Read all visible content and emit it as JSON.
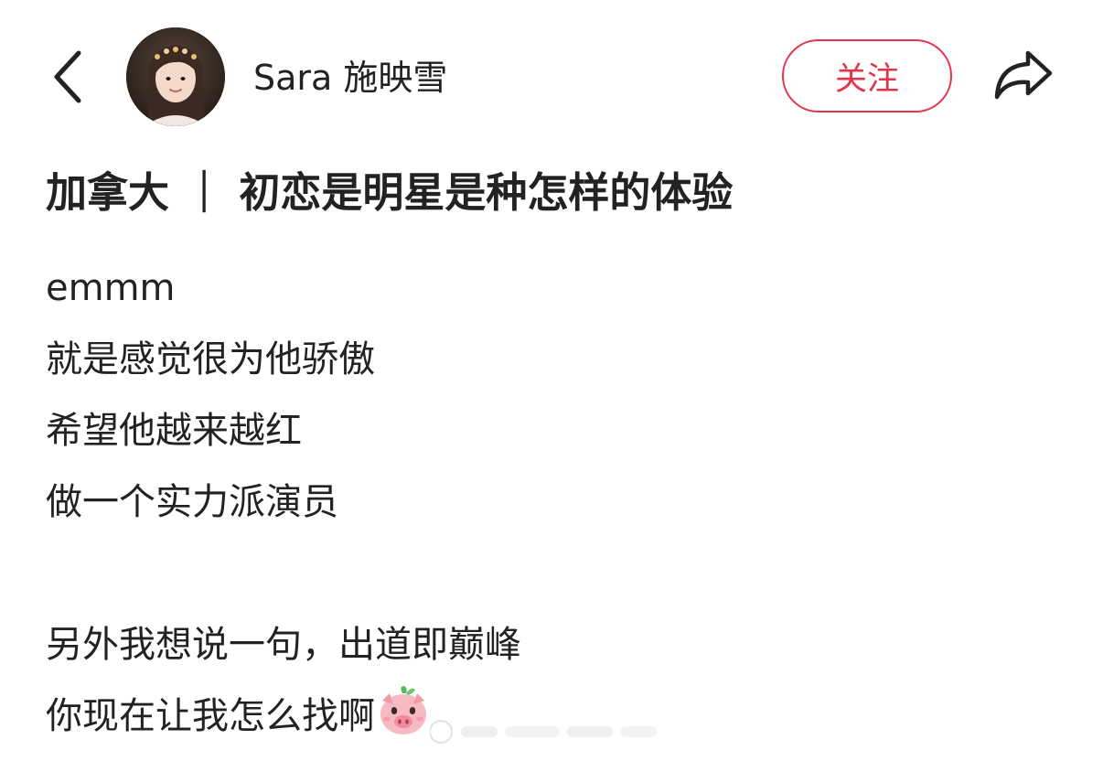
{
  "header": {
    "author_name": "Sara 施映雪",
    "follow_label": "关注"
  },
  "post": {
    "title": "加拿大 ｜ 初恋是明星是种怎样的体验",
    "lines": [
      "emmm",
      "就是感觉很为他骄傲",
      "希望他越来越红",
      "做一个实力派演员",
      "",
      "另外我想说一句，出道即巅峰",
      "你现在让我怎么找啊"
    ]
  },
  "icons": {
    "back": "chevron-left-icon",
    "share": "share-arrow-icon",
    "emoji": "pig-face-emoji"
  },
  "colors": {
    "accent": "#e3344a",
    "text": "#222222"
  }
}
